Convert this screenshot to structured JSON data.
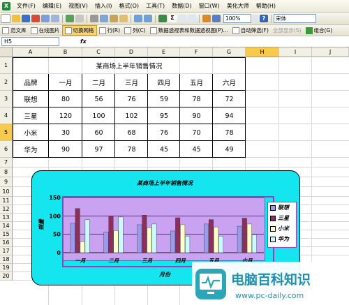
{
  "menubar": {
    "items": [
      "文件(F)",
      "编辑(E)",
      "视图(V)",
      "插入(I)",
      "格式(O)",
      "工具(T)",
      "数据(D)",
      "窗口(W)",
      "美化大师",
      "帮助(H)"
    ]
  },
  "toolbar1": {
    "zoom": "100%",
    "help_label": "?",
    "font": "宋体"
  },
  "toolbar2": {
    "buttons": [
      "范文库",
      "在线图片",
      "切换网格",
      "行(R)",
      "列(C)",
      "数据透视表和数据透视图(P)...",
      "自动筛选(F)",
      "全部显示(S)",
      "组合(G)"
    ]
  },
  "formulabar": {
    "name_box": "H5",
    "fx": "fx",
    "formula": ""
  },
  "columns": [
    "A",
    "B",
    "C",
    "D",
    "E",
    "F",
    "G",
    "H",
    "I",
    "J"
  ],
  "rows": [
    "1",
    "2",
    "3",
    "4",
    "5",
    "6",
    "7",
    "8",
    "9",
    "10",
    "11",
    "12",
    "13",
    "14",
    "15",
    "16",
    "17",
    "18",
    "19",
    "20"
  ],
  "selected": {
    "column": "H",
    "row": "5"
  },
  "table": {
    "title": "某商场上半年销售情况",
    "header": [
      "品牌",
      "一月",
      "二月",
      "三月",
      "四月",
      "五月",
      "六月"
    ],
    "rows": [
      [
        "联想",
        "80",
        "56",
        "76",
        "59",
        "78",
        "72"
      ],
      [
        "三星",
        "120",
        "100",
        "102",
        "95",
        "90",
        "94"
      ],
      [
        "小米",
        "30",
        "60",
        "68",
        "76",
        "70",
        "78"
      ],
      [
        "华为",
        "90",
        "97",
        "78",
        "45",
        "45",
        "49"
      ]
    ]
  },
  "chart_data": {
    "type": "bar",
    "title": "某商场上半年销售情况",
    "xlabel": "月份",
    "ylabel": "销量",
    "categories": [
      "一月",
      "二月",
      "三月",
      "四月",
      "五月",
      "六月"
    ],
    "series": [
      {
        "name": "联想",
        "values": [
          80,
          56,
          76,
          59,
          78,
          72
        ],
        "color": "#9a9af0"
      },
      {
        "name": "三星",
        "values": [
          120,
          100,
          102,
          95,
          90,
          94
        ],
        "color": "#8c2f5b"
      },
      {
        "name": "小米",
        "values": [
          30,
          60,
          68,
          76,
          70,
          78
        ],
        "color": "#ffffc8"
      },
      {
        "name": "华为",
        "values": [
          90,
          97,
          78,
          45,
          45,
          49
        ],
        "color": "#c8fbff"
      }
    ],
    "ylim": [
      0,
      150
    ],
    "yticks": [
      "0",
      "50",
      "100",
      "150"
    ],
    "grid": true,
    "legend_position": "right",
    "colors": {
      "chart_bg": "#15e5ef",
      "plot_bg": "#c9a2f2"
    }
  },
  "watermark": {
    "title": "电脑百科知识",
    "url": "www.pc-daily.com"
  }
}
